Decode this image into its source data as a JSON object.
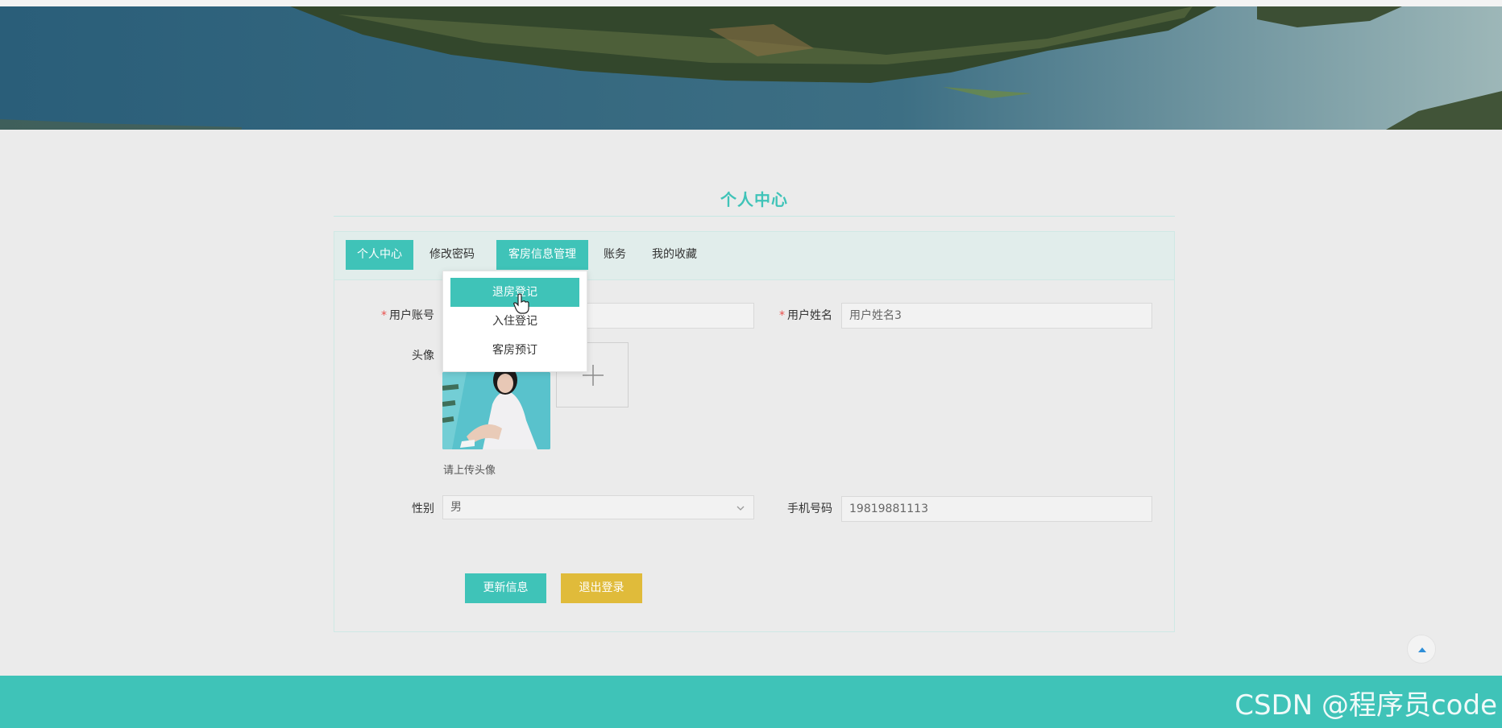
{
  "page": {
    "title": "个人中心",
    "accent_color": "#3fc3b8",
    "warning_color": "#e0bb3a"
  },
  "tabs": [
    {
      "label": "个人中心",
      "active": true
    },
    {
      "label": "修改密码",
      "active": false
    },
    {
      "label": "客房信息管理",
      "active": true
    },
    {
      "label": "账务",
      "active": false
    },
    {
      "label": "我的收藏",
      "active": false
    }
  ],
  "dropdown": {
    "items": [
      {
        "label": "退房登记",
        "highlighted": true
      },
      {
        "label": "入住登记",
        "highlighted": false
      },
      {
        "label": "客房预订",
        "highlighted": false
      }
    ]
  },
  "form": {
    "account": {
      "label": "用户账号",
      "required_mark": "*",
      "value": ""
    },
    "name": {
      "label": "用户姓名",
      "required_mark": "*",
      "value": "用户姓名3"
    },
    "avatar": {
      "label": "头像",
      "hint": "请上传头像",
      "upload_icon": "plus-icon"
    },
    "gender": {
      "label": "性别",
      "value": "男",
      "icon": "chevron-down-icon"
    },
    "phone": {
      "label": "手机号码",
      "value": "19819881113"
    }
  },
  "buttons": {
    "update": "更新信息",
    "logout": "退出登录"
  },
  "back_to_top_icon": "triangle-up-icon",
  "watermark": "CSDN @程序员code"
}
